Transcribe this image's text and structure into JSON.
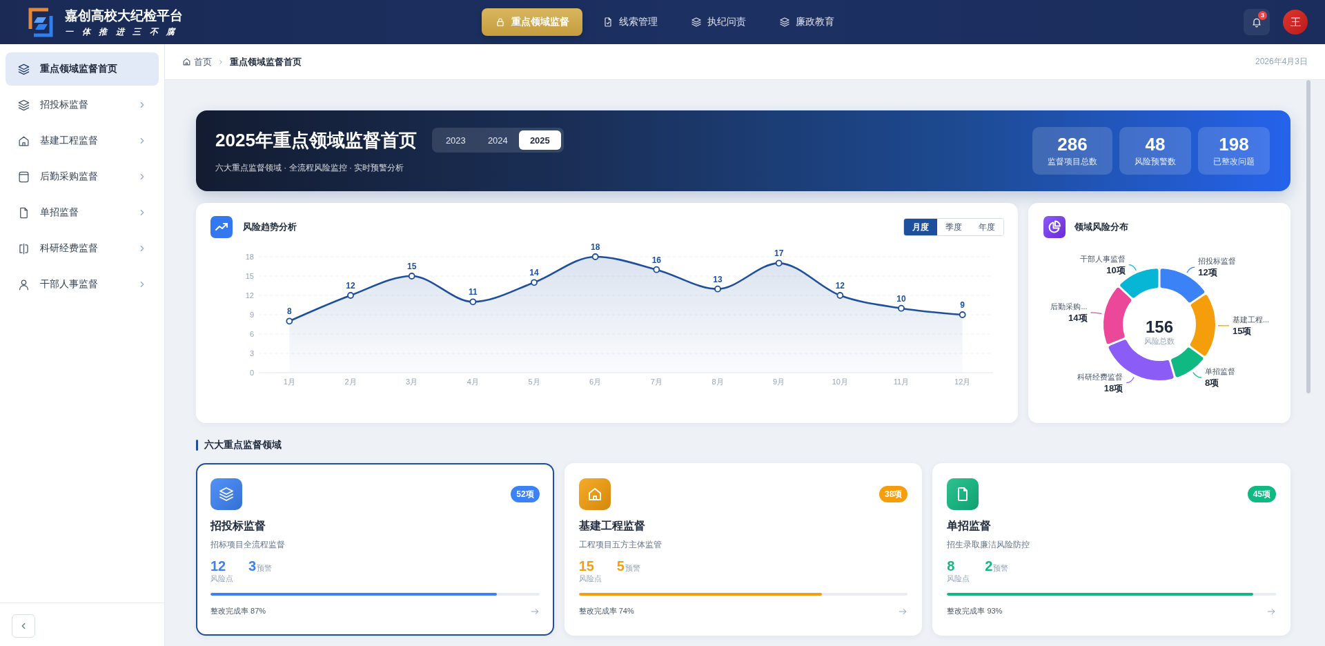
{
  "header": {
    "title": "嘉创高校大纪检平台",
    "slogan": "一 体 推 进 三 不 腐",
    "nav": [
      {
        "label": "重点领域监督",
        "selected": true
      },
      {
        "label": "线索管理",
        "selected": false
      },
      {
        "label": "执纪问责",
        "selected": false
      },
      {
        "label": "廉政教育",
        "selected": false
      }
    ],
    "notification_count": "3",
    "avatar_initial": "王"
  },
  "sidebar": {
    "items": [
      {
        "label": "重点领域监督首页",
        "kind": "page",
        "selected": true
      },
      {
        "label": "招投标监督",
        "kind": "group",
        "selected": false
      },
      {
        "label": "基建工程监督",
        "kind": "group",
        "selected": false
      },
      {
        "label": "后勤采购监督",
        "kind": "group",
        "selected": false
      },
      {
        "label": "单招监督",
        "kind": "group",
        "selected": false
      },
      {
        "label": "科研经费监督",
        "kind": "group",
        "selected": false
      },
      {
        "label": "干部人事监督",
        "kind": "group",
        "selected": false
      }
    ]
  },
  "breadcrumb": {
    "items": [
      "首页",
      "重点领域监督首页"
    ],
    "date": "2026年4月3日"
  },
  "banner": {
    "title": "2025年重点领域监督首页",
    "subtitle": "六大重点监督领域 · 全流程风险监控 · 实时预警分析",
    "years": [
      {
        "label": "2023",
        "selected": false
      },
      {
        "label": "2024",
        "selected": false
      },
      {
        "label": "2025",
        "selected": true
      }
    ],
    "stats": [
      {
        "value": "286",
        "label": "监督项目总数"
      },
      {
        "value": "48",
        "label": "风险预警数"
      },
      {
        "value": "198",
        "label": "已整改问题"
      }
    ]
  },
  "trend": {
    "title": "风险趋势分析",
    "periods": [
      {
        "label": "月度",
        "selected": true
      },
      {
        "label": "季度",
        "selected": false
      },
      {
        "label": "年度",
        "selected": false
      }
    ],
    "chart_data": {
      "type": "area",
      "categories": [
        "1月",
        "2月",
        "3月",
        "4月",
        "5月",
        "6月",
        "7月",
        "8月",
        "9月",
        "10月",
        "11月",
        "12月"
      ],
      "series": [
        {
          "color": "#1e4f9c",
          "marker": "circle",
          "values": [
            8,
            12,
            15,
            11,
            14,
            18,
            16,
            13,
            17,
            12,
            10,
            9
          ]
        }
      ],
      "ylim": [
        0,
        18
      ],
      "yticks": [
        0,
        3,
        6,
        9,
        12,
        15,
        18
      ],
      "grid": true,
      "data_labels": true
    }
  },
  "distribution": {
    "title": "领域风险分布",
    "total": "156",
    "total_label": "风险总数",
    "chart_data": {
      "type": "donut",
      "categories": [
        "招投标监督",
        "基建工程...",
        "单招监督",
        "科研经费监督",
        "后勤采购...",
        "干部人事监督"
      ],
      "values": [
        12,
        15,
        8,
        18,
        14,
        10
      ],
      "colors": [
        "#3b82f6",
        "#f59e0b",
        "#10b981",
        "#8b5cf6",
        "#ec4899",
        "#06b6d4"
      ],
      "value_labels": [
        "12项",
        "15项",
        "8项",
        "18项",
        "14项",
        "10项"
      ]
    }
  },
  "areas": {
    "title": "六大重点监督领域",
    "cards": [
      {
        "title": "招投标监督",
        "description": "招标项目全流程监督",
        "badge": "52项",
        "color": "#3b82f6",
        "risk_count": "12",
        "risk_label": "风险点",
        "warning_count": "3",
        "warning_label": "预警",
        "completion": "整改完成率 87%",
        "level": 0.87,
        "selected": true
      },
      {
        "title": "基建工程监督",
        "description": "工程项目五方主体监管",
        "badge": "38项",
        "color": "#f59e0b",
        "risk_count": "15",
        "risk_label": "风险点",
        "warning_count": "5",
        "warning_label": "预警",
        "completion": "整改完成率 74%",
        "level": 0.74,
        "selected": false
      },
      {
        "title": "单招监督",
        "description": "招生录取廉洁风险防控",
        "badge": "45项",
        "color": "#10b981",
        "risk_count": "8",
        "risk_label": "风险点",
        "warning_count": "2",
        "warning_label": "预警",
        "completion": "整改完成率 93%",
        "level": 0.93,
        "selected": false
      }
    ]
  }
}
